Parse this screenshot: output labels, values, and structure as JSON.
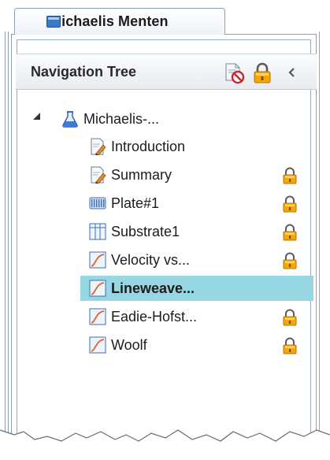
{
  "tab": {
    "title": "Michaelis Menten"
  },
  "panel": {
    "title": "Navigation Tree"
  },
  "tree": {
    "root": {
      "label": "Michaelis-...",
      "icon": "flask-icon"
    },
    "items": [
      {
        "label": "Introduction",
        "icon": "document-pen-icon",
        "locked": false,
        "selected": false
      },
      {
        "label": "Summary",
        "icon": "document-pen-icon",
        "locked": true,
        "selected": false
      },
      {
        "label": "Plate#1",
        "icon": "plate-icon",
        "locked": true,
        "selected": false
      },
      {
        "label": "Substrate1",
        "icon": "table-icon",
        "locked": true,
        "selected": false
      },
      {
        "label": "Velocity vs...",
        "icon": "graph-icon",
        "locked": true,
        "selected": false
      },
      {
        "label": "Lineweave...",
        "icon": "graph-icon",
        "locked": false,
        "selected": true
      },
      {
        "label": "Eadie-Hofst...",
        "icon": "graph-icon",
        "locked": true,
        "selected": false
      },
      {
        "label": "Woolf",
        "icon": "graph-icon",
        "locked": true,
        "selected": false
      }
    ]
  },
  "colors": {
    "selection": "#97d6e3",
    "lock": "#f0a000"
  }
}
